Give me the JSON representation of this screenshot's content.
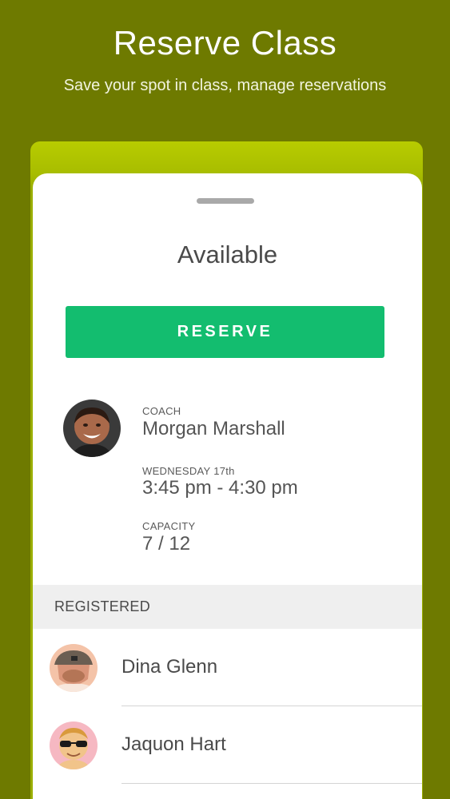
{
  "promo": {
    "title": "Reserve Class",
    "subtitle": "Save your spot in class, manage reservations"
  },
  "sheet": {
    "status": "Available",
    "reserve_label": "RESERVE"
  },
  "details": {
    "coach_label": "COACH",
    "coach_name": "Morgan Marshall",
    "date_label": "WEDNESDAY 17th",
    "time": "3:45 pm - 4:30 pm",
    "capacity_label": "CAPACITY",
    "capacity": "7 / 12"
  },
  "registered": {
    "header": "REGISTERED",
    "people": [
      {
        "name": "Dina Glenn"
      },
      {
        "name": "Jaquon Hart"
      }
    ]
  },
  "colors": {
    "background": "#6e7a00",
    "frame_accent": "#b8cc00",
    "reserve_button": "#13bd6f"
  }
}
